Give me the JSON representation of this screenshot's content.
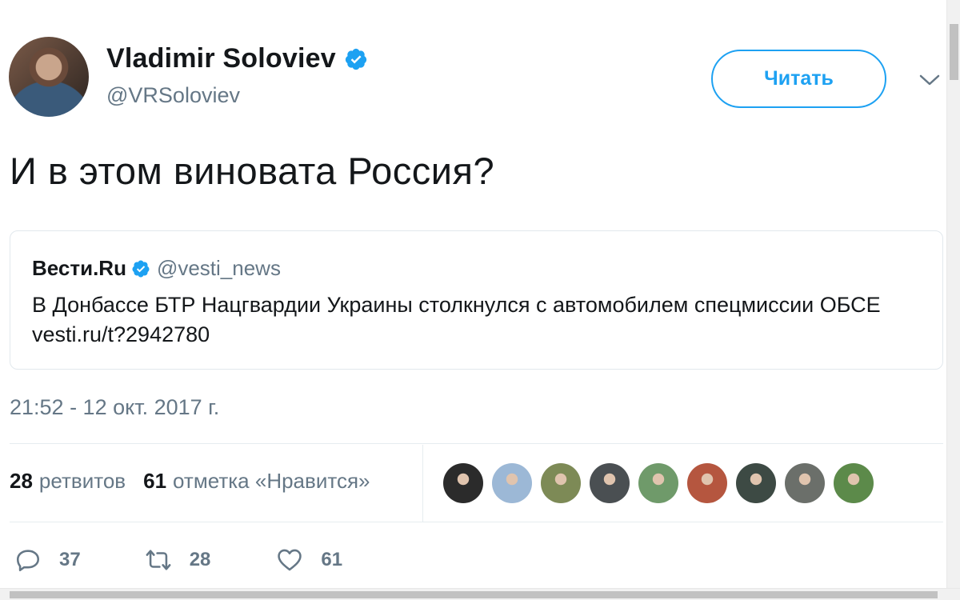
{
  "author": {
    "name": "Vladimir Soloviev",
    "handle": "@VRSoloviev",
    "verified": true
  },
  "follow_button": {
    "label": "Читать"
  },
  "tweet": {
    "text": "И в этом виновата Россия?",
    "timestamp": "21:52 - 12 окт. 2017 г."
  },
  "quote": {
    "name": "Вести.Ru",
    "handle": "@vesti_news",
    "verified": true,
    "text": "В Донбассе БТР Нацгвардии Украины столкнулся с автомобилем спецмиссии ОБСЕ vesti.ru/t?2942780"
  },
  "stats": {
    "retweets_count": "28",
    "retweets_label": "ретвитов",
    "likes_count": "61",
    "likes_label": "отметка «Нравится»"
  },
  "likers": [
    {
      "name": "liker-1",
      "color": "#2b2b2b"
    },
    {
      "name": "liker-2",
      "color": "#9cb8d6"
    },
    {
      "name": "liker-3",
      "color": "#7d8a56"
    },
    {
      "name": "liker-4",
      "color": "#4a4f52"
    },
    {
      "name": "liker-5",
      "color": "#6f9a6a"
    },
    {
      "name": "liker-6",
      "color": "#b5563f"
    },
    {
      "name": "liker-7",
      "color": "#3d4a44"
    },
    {
      "name": "liker-8",
      "color": "#6b6f6a"
    },
    {
      "name": "liker-9",
      "color": "#5c8a4a"
    }
  ],
  "actions": {
    "reply_count": "37",
    "retweet_count": "28",
    "like_count": "61"
  },
  "colors": {
    "accent": "#1da1f2",
    "muted": "#657786",
    "text": "#14171a",
    "border": "#e1e8ed"
  },
  "icons": [
    "verified-badge-icon",
    "chevron-down-icon",
    "reply-icon",
    "retweet-icon",
    "heart-icon"
  ]
}
